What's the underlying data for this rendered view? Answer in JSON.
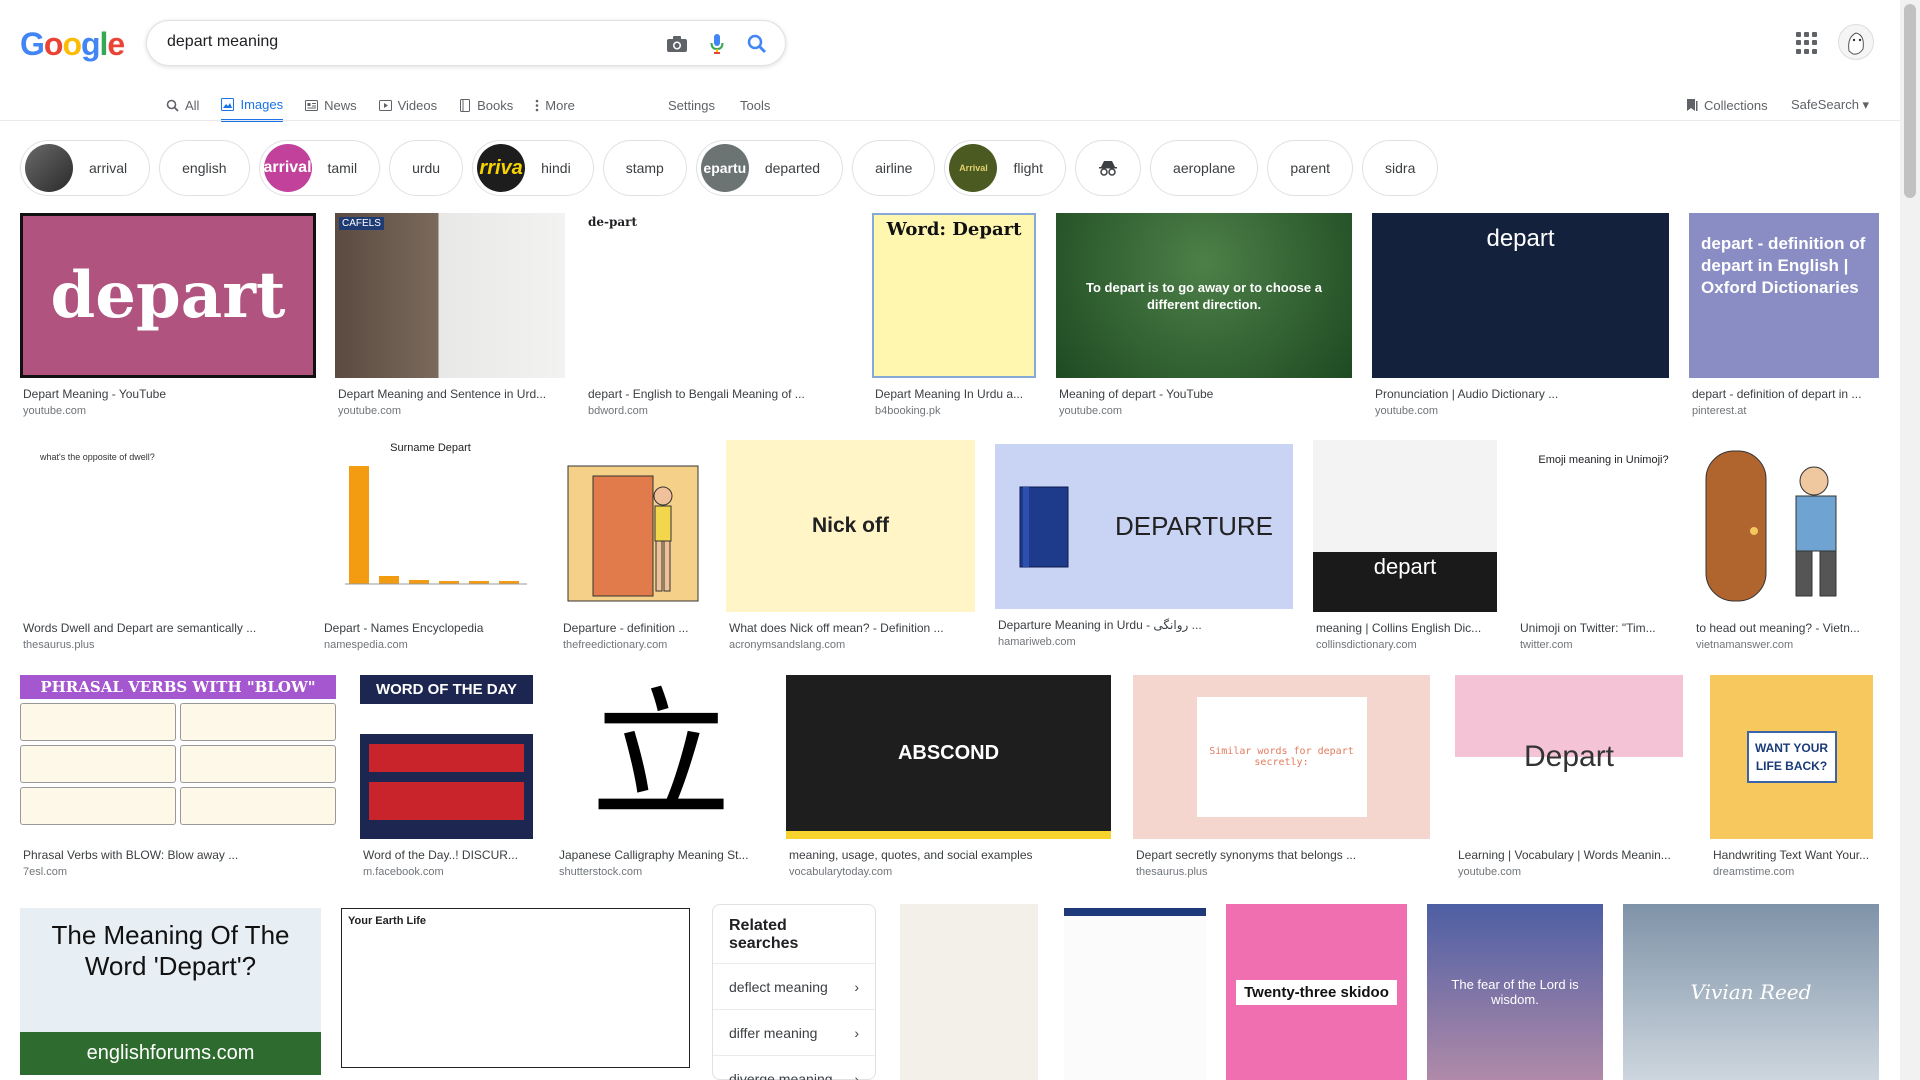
{
  "search": {
    "query": "depart meaning"
  },
  "logo": [
    "G",
    "o",
    "o",
    "g",
    "l",
    "e"
  ],
  "tabs": [
    {
      "label": "All",
      "icon": "search-icon"
    },
    {
      "label": "Images",
      "icon": "image-icon"
    },
    {
      "label": "News",
      "icon": "news-icon"
    },
    {
      "label": "Videos",
      "icon": "video-icon"
    },
    {
      "label": "Books",
      "icon": "book-icon"
    },
    {
      "label": "More",
      "icon": "more-vert-icon"
    }
  ],
  "tools": {
    "settings": "Settings",
    "tools": "Tools",
    "collections": "Collections",
    "safesearch": "SafeSearch ▾"
  },
  "chips": [
    {
      "label": "arrival",
      "thumb": ""
    },
    {
      "label": "english"
    },
    {
      "label": "tamil",
      "thumb": "arrival"
    },
    {
      "label": "urdu"
    },
    {
      "label": "hindi",
      "thumb": "rriva"
    },
    {
      "label": "stamp"
    },
    {
      "label": "departed",
      "thumb": "epartu"
    },
    {
      "label": "airline"
    },
    {
      "label": "flight",
      "thumb": "Arrival"
    },
    {
      "label": "",
      "icon": "incognito-icon"
    },
    {
      "label": "aeroplane"
    },
    {
      "label": "parent"
    },
    {
      "label": "sidra"
    }
  ],
  "row1": [
    {
      "caption": "Depart Meaning - YouTube",
      "source": "youtube.com",
      "art": "depart"
    },
    {
      "caption": "Depart Meaning and Sentence in Urd...",
      "source": "youtube.com",
      "art": "CAFELS"
    },
    {
      "caption": "depart - English to Bengali Meaning of ...",
      "source": "bdword.com",
      "art": "de-part"
    },
    {
      "caption": "Depart Meaning In Urdu a...",
      "source": "b4booking.pk",
      "art": "Word: Depart"
    },
    {
      "caption": "Meaning of depart - YouTube",
      "source": "youtube.com",
      "art": "To depart is to go away or to choose a different direction."
    },
    {
      "caption": "Pronunciation | Audio Dictionary ...",
      "source": "youtube.com",
      "art": "depart"
    },
    {
      "caption": "depart - definition of depart in ...",
      "source": "pinterest.at",
      "art": "depart - definition of depart in English | Oxford Dictionaries"
    }
  ],
  "row2": [
    {
      "caption": "Words Dwell and Depart are semantically ...",
      "source": "thesaurus.plus",
      "art": "what's the opposite of dwell?"
    },
    {
      "caption": "Depart - Names Encyclopedia",
      "source": "namespedia.com",
      "art": "Surname Depart"
    },
    {
      "caption": "Departure - definition ...",
      "source": "thefreedictionary.com"
    },
    {
      "caption": "What does Nick off mean? - Definition ...",
      "source": "acronymsandslang.com",
      "art": "Nick off"
    },
    {
      "caption": "Departure Meaning in Urdu - روانگی ...",
      "source": "hamariweb.com",
      "art": "DEPARTURE"
    },
    {
      "caption": "meaning | Collins English Dic...",
      "source": "collinsdictionary.com",
      "art": "depart"
    },
    {
      "caption": "Unimoji on Twitter: \"Tim...",
      "source": "twitter.com",
      "art": "Emoji meaning in Unimoji?"
    },
    {
      "caption": "to head out meaning? - Vietn...",
      "source": "vietnamanswer.com"
    }
  ],
  "row3": [
    {
      "caption": "Phrasal Verbs with BLOW: Blow away ...",
      "source": "7esl.com",
      "art": "PHRASAL VERBS WITH \"BLOW\""
    },
    {
      "caption": "Word of the Day..! DISCUR...",
      "source": "m.facebook.com",
      "art": "WORD OF THE DAY"
    },
    {
      "caption": "Japanese Calligraphy Meaning St...",
      "source": "shutterstock.com",
      "art": "立"
    },
    {
      "caption": "meaning, usage, quotes, and social examples",
      "source": "vocabularytoday.com",
      "art": "ABSCOND"
    },
    {
      "caption": "Depart secretly synonyms that belongs ...",
      "source": "thesaurus.plus",
      "art": "Similar words for depart secretly:"
    },
    {
      "caption": "Learning | Vocabulary | Words Meanin...",
      "source": "youtube.com",
      "art": "Depart"
    },
    {
      "caption": "Handwriting Text Want Your...",
      "source": "dreamstime.com",
      "art": "WANT YOUR LIFE BACK?"
    }
  ],
  "row4": [
    {
      "art": "The Meaning Of The Word 'Depart'?",
      "sub": "englishforums.com"
    },
    {
      "art": "Your Earth Life"
    },
    {
      "art": ""
    },
    {
      "art": ""
    },
    {
      "art": "Twenty-three skidoo"
    },
    {
      "art": "The fear of the Lord is wisdom."
    },
    {
      "art": "Vivian Reed"
    }
  ],
  "related": {
    "title": "Related searches",
    "items": [
      "deflect meaning",
      "differ meaning",
      "diverge meaning"
    ]
  },
  "colors": {
    "accent": "#1a73e8",
    "chip_border": "#dfe1e5"
  }
}
